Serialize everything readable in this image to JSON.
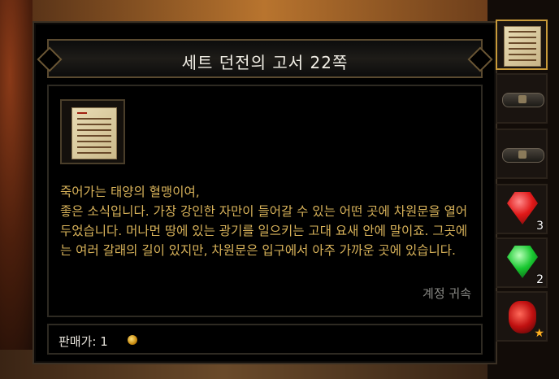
{
  "tooltip": {
    "title": "세트 던전의 고서 22쪽",
    "description": "죽어가는 태양의 혈맹이여,\n좋은 소식입니다. 가장 강인한 자만이 들어갈 수 있는 어떤 곳에 차원문을 열어 두었습니다. 머나먼 땅에 있는 광기를 일으키는 고대 요새 안에 말이죠. 그곳에는 여러 갈래의 길이 있지만, 차원문은 입구에서 아주 가까운 곳에 있습니다.",
    "binding": "계정 귀속",
    "price_label": "판매가: 1",
    "item_icon": "scroll-page-icon",
    "currency_icon": "gold-coin-icon"
  },
  "inventory": {
    "slots": [
      {
        "icon": "scroll-page-icon",
        "count": "",
        "selected": true
      },
      {
        "icon": "belt-icon",
        "count": ""
      },
      {
        "icon": "belt-icon",
        "count": ""
      },
      {
        "icon": "red-gem-icon",
        "count": "3"
      },
      {
        "icon": "green-gem-icon",
        "count": "2"
      },
      {
        "icon": "red-potion-icon",
        "count": ""
      }
    ]
  },
  "colors": {
    "description_text": "#d9b35a",
    "title_text": "#f2efe6",
    "binding_text": "#8a8a86",
    "selected_border": "#c89a3a"
  }
}
